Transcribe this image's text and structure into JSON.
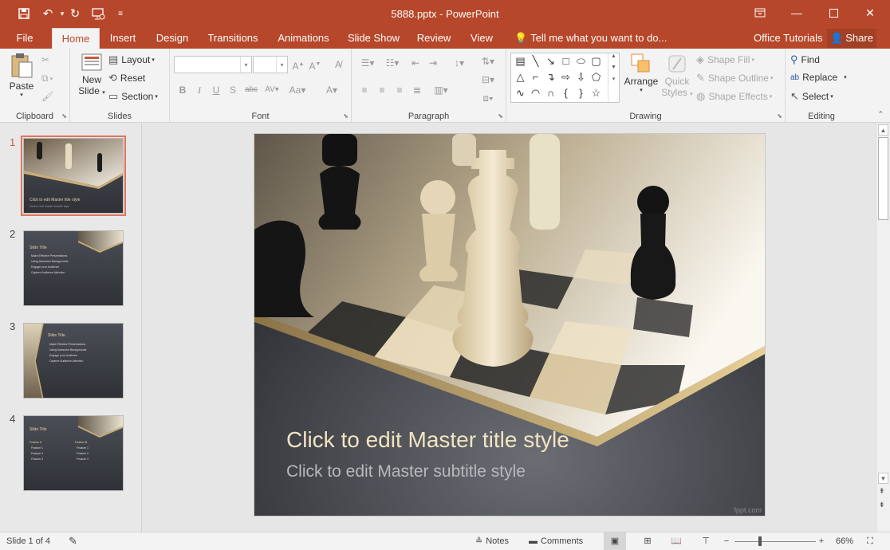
{
  "window": {
    "title": "5888.pptx - PowerPoint",
    "qat": {
      "save": "save-icon",
      "undo": "undo-icon",
      "redo": "redo-icon",
      "present": "present-from-start-icon",
      "customize": "customize-qat-icon"
    },
    "controls": {
      "ribbon_display": "ribbon-display-icon",
      "minimize": "minimize-icon",
      "maximize": "maximize-icon",
      "close": "close-icon"
    }
  },
  "tabs": [
    {
      "label": "File"
    },
    {
      "label": "Home"
    },
    {
      "label": "Insert"
    },
    {
      "label": "Design"
    },
    {
      "label": "Transitions"
    },
    {
      "label": "Animations"
    },
    {
      "label": "Slide Show"
    },
    {
      "label": "Review"
    },
    {
      "label": "View"
    }
  ],
  "active_tab": "Home",
  "tell_me": "Tell me what you want to do...",
  "office_tutorials": "Office Tutorials",
  "share": "Share",
  "ribbon": {
    "clipboard": {
      "label": "Clipboard",
      "paste": "Paste"
    },
    "slides": {
      "label": "Slides",
      "new_slide_1": "New",
      "new_slide_2": "Slide",
      "layout": "Layout",
      "reset": "Reset",
      "section": "Section"
    },
    "font": {
      "label": "Font",
      "font_name": "",
      "font_size": ""
    },
    "paragraph": {
      "label": "Paragraph"
    },
    "drawing": {
      "label": "Drawing",
      "arrange": "Arrange",
      "quick_styles_1": "Quick",
      "quick_styles_2": "Styles",
      "shape_fill": "Shape Fill",
      "shape_outline": "Shape Outline",
      "shape_effects": "Shape Effects"
    },
    "editing": {
      "label": "Editing",
      "find": "Find",
      "replace": "Replace",
      "select": "Select"
    }
  },
  "thumbnails": [
    {
      "num": "1",
      "title": "Click to edit Master title style",
      "lines": [
        "Click to edit Master subtitle style"
      ]
    },
    {
      "num": "2",
      "title": "Slide Title",
      "lines": [
        "Make Effective Presentations",
        "Using Awesome Backgrounds",
        "Engage your Audience",
        "Capture Audience Attention"
      ]
    },
    {
      "num": "3",
      "title": "Slide Title",
      "lines": [
        "Make Effective Presentations",
        "Using Awesome Backgrounds",
        "Engage your Audience",
        "Capture Audience Attention"
      ]
    },
    {
      "num": "4",
      "title": "Slide Title",
      "col_a": "Feature A",
      "col_b": "Feature B",
      "lines_a": [
        "Feature 1",
        "Feature 2",
        "Feature 3"
      ],
      "lines_b": [
        "Feature 1",
        "Feature 2",
        "Feature 3"
      ]
    }
  ],
  "slide": {
    "title": "Click to edit Master title style",
    "subtitle": "Click to edit Master subtitle style",
    "brand": "fppt.com"
  },
  "status": {
    "slide_info": "Slide 1 of 4",
    "notes": "Notes",
    "comments": "Comments",
    "zoom": "66%"
  },
  "colors": {
    "accent": "#b7472a",
    "selection": "#e0755a"
  }
}
